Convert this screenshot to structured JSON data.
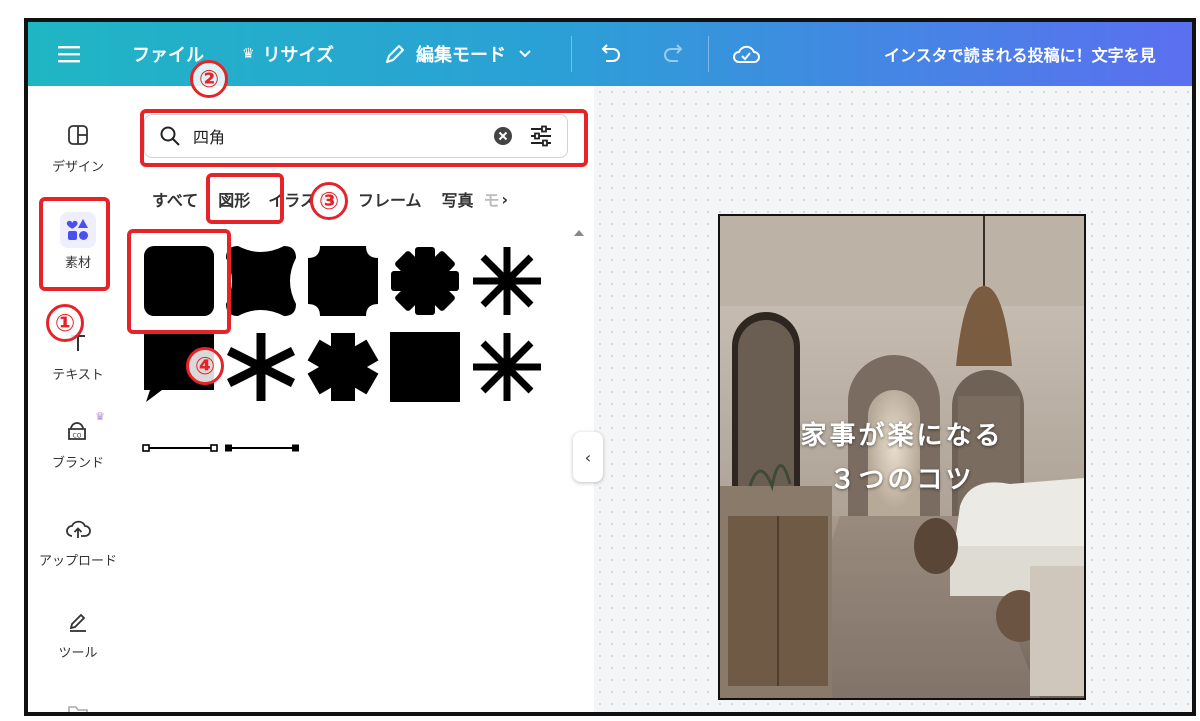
{
  "topbar": {
    "file_label": "ファイル",
    "resize_label": "リサイズ",
    "edit_mode_label": "編集モード",
    "title": "インスタで読まれる投稿に！文字を見"
  },
  "sidebar": {
    "items": [
      {
        "label": "デザイン"
      },
      {
        "label": "素材"
      },
      {
        "label": "テキスト"
      },
      {
        "label": "ブランド"
      },
      {
        "label": "アップロード"
      },
      {
        "label": "ツール"
      }
    ]
  },
  "search": {
    "value": "四角"
  },
  "tabs": [
    {
      "label": "すべて"
    },
    {
      "label": "図形"
    },
    {
      "label": "イラスト"
    },
    {
      "label": "フレーム"
    },
    {
      "label": "写真"
    },
    {
      "label": "モ"
    }
  ],
  "design": {
    "line1": "家事が楽になる",
    "line2": "３つのコツ"
  },
  "annotations": [
    "①",
    "②",
    "③",
    "④"
  ],
  "colors": {
    "accent_red": "#e5242a",
    "gradient_start": "#1fb6c4",
    "gradient_end": "#5b6ff0",
    "selected_icon": "#4a4ff0"
  }
}
